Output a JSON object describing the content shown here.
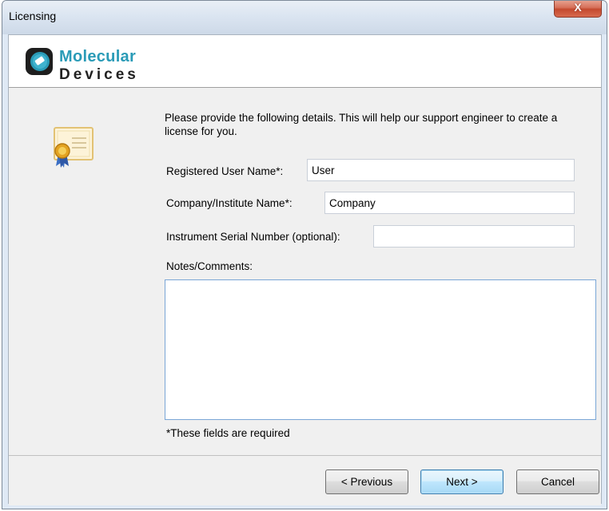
{
  "window": {
    "title": "Licensing",
    "close_glyph": "X"
  },
  "logo": {
    "line1": "Molecular",
    "line2": "Devices",
    "icon": "molecular-devices-logo-icon"
  },
  "intro_text": "Please provide the following details. This will help our support engineer to create a license for you.",
  "fields": {
    "user_name": {
      "label": "Registered User Name*:",
      "value": "User"
    },
    "company": {
      "label": "Company/Institute Name*:",
      "value": "Company"
    },
    "serial": {
      "label": "Instrument Serial Number (optional):",
      "value": ""
    },
    "notes": {
      "label": "Notes/Comments:",
      "value": ""
    }
  },
  "required_note": "*These fields are required",
  "buttons": {
    "previous": "< Previous",
    "next": "Next >",
    "cancel": "Cancel"
  },
  "colors": {
    "logo_accent": "#2a9bb7",
    "close_button": "#c44a2f",
    "default_button_border": "#3c7fb1"
  }
}
